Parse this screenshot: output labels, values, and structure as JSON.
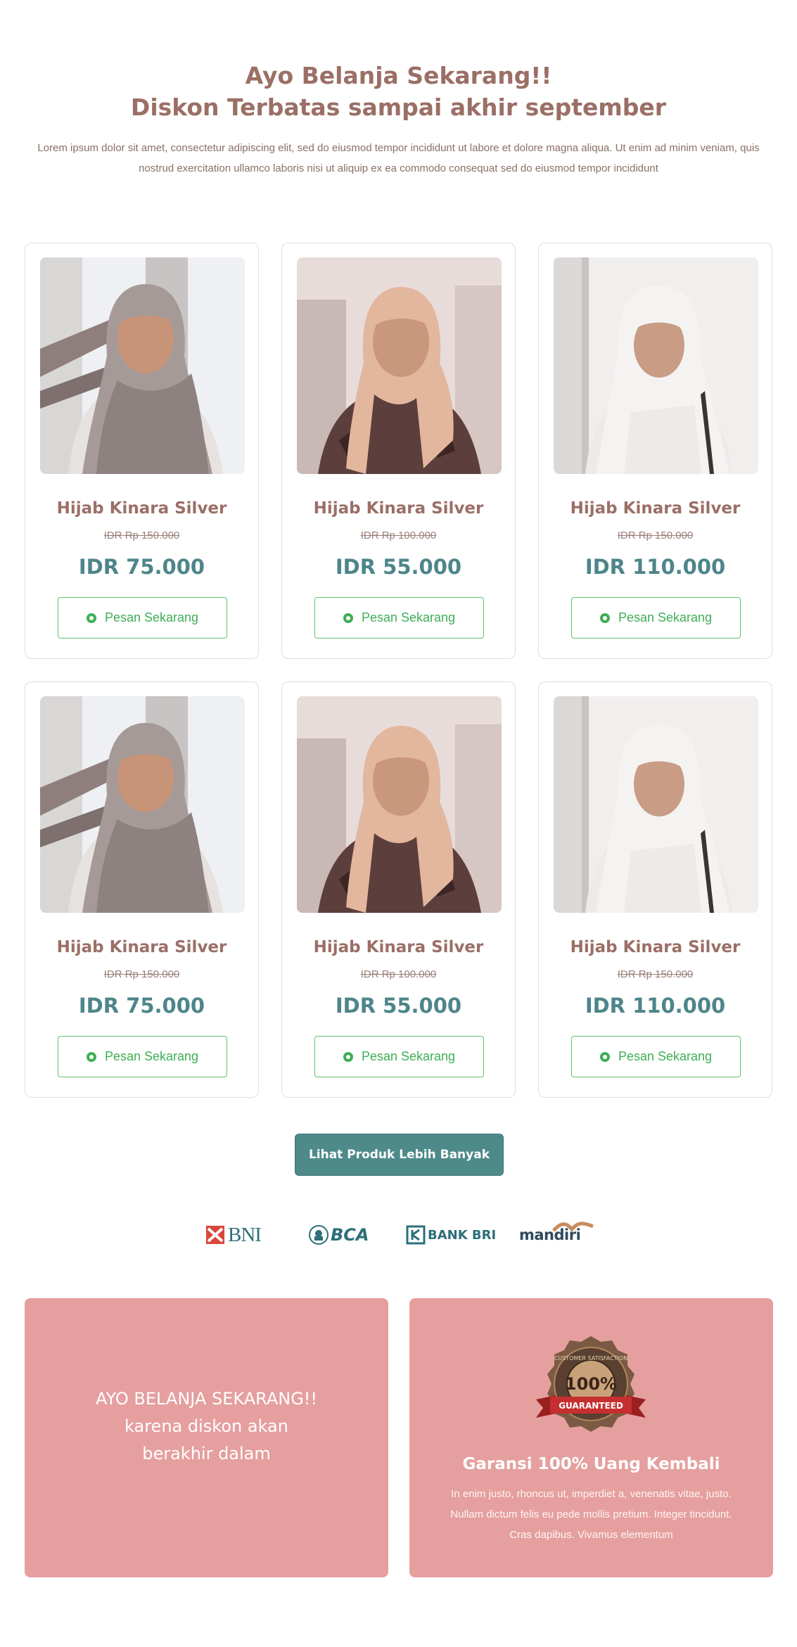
{
  "hero": {
    "title_line1": "Ayo Belanja Sekarang!!",
    "title_line2": "Diskon Terbatas sampai akhir september",
    "description": "Lorem ipsum dolor sit amet, consectetur adipiscing elit, sed do eiusmod tempor incididunt ut labore et dolore magna aliqua. Ut enim ad minim veniam, quis nostrud exercitation ullamco laboris nisi ut aliquip ex ea commodo consequat sed do eiusmod tempor incididunt"
  },
  "products": [
    {
      "name": "Hijab Kinara Silver",
      "old_price": "IDR Rp 150.000",
      "price": "IDR 75.000",
      "button": "Pesan Sekarang"
    },
    {
      "name": "Hijab Kinara Silver",
      "old_price": "IDR Rp 100.000",
      "price": "IDR 55.000",
      "button": "Pesan Sekarang"
    },
    {
      "name": "Hijab Kinara Silver",
      "old_price": "IDR Rp 150.000",
      "price": "IDR 110.000",
      "button": "Pesan Sekarang"
    },
    {
      "name": "Hijab Kinara Silver",
      "old_price": "IDR Rp 150.000",
      "price": "IDR 75.000",
      "button": "Pesan Sekarang"
    },
    {
      "name": "Hijab Kinara Silver",
      "old_price": "IDR Rp 100.000",
      "price": "IDR 55.000",
      "button": "Pesan Sekarang"
    },
    {
      "name": "Hijab Kinara Silver",
      "old_price": "IDR Rp 150.000",
      "price": "IDR 110.000",
      "button": "Pesan Sekarang"
    }
  ],
  "more_button": "Lihat Produk Lebih Banyak",
  "banks": {
    "bni": "BNI",
    "bca": "BCA",
    "bri": "BANK BRI",
    "mandiri": "mandiri"
  },
  "promo": {
    "line1": "AYO BELANJA SEKARANG!!",
    "line2": "karena diskon akan",
    "line3": "berakhir dalam"
  },
  "guarantee": {
    "badge_top": "CUSTOMER SATISFACTION",
    "badge_percent": "100%",
    "badge_ribbon": "GUARANTEED",
    "title": "Garansi 100% Uang Kembali",
    "text": "In enim justo, rhoncus ut, imperdiet a, venenatis vitae, justo. Nullam dictum felis eu pede mollis pretium. Integer tincidunt. Cras dapibus. Vivamus elementum"
  },
  "colors": {
    "accent_brown": "#9b6f66",
    "price_teal": "#4d858a",
    "whatsapp_green": "#3fae55",
    "panel_pink": "#e59f9e",
    "button_teal": "#4f8a8b"
  }
}
